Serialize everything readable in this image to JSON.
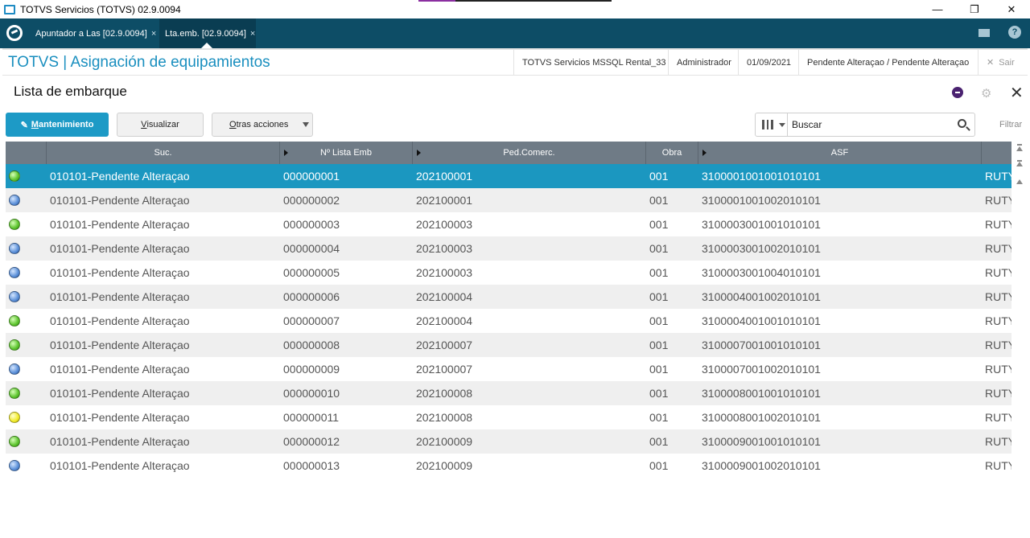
{
  "window": {
    "title": "TOTVS Servicios (TOTVS) 02.9.0094",
    "minimize": "—",
    "maximize": "❐",
    "close": "✕"
  },
  "tabs": [
    {
      "label": "Apuntador a Las [02.9.0094]",
      "close": "×"
    },
    {
      "label": "Lta.emb. [02.9.0094]",
      "close": "×"
    }
  ],
  "tabbar_icons": {
    "logo": "totvs-logo-icon",
    "mail": "mail-icon",
    "help": "help-icon",
    "help_glyph": "?"
  },
  "header": {
    "app_title": "TOTVS | Asignación de equipamientos",
    "environment": "TOTVS Servicios MSSQL Rental_33",
    "user": "Administrador",
    "date": "01/09/2021",
    "status": "Pendente Alteraçao / Pendente Alteraçao",
    "exit_label": "Sair",
    "exit_glyph": "✕"
  },
  "page": {
    "title": "Lista de embarque",
    "close_glyph": "✕",
    "gear_glyph": "⚙"
  },
  "toolbar": {
    "mantenimiento_first": "M",
    "mantenimiento_rest": "antenimiento",
    "visualizar_first": "V",
    "visualizar_rest": "isualizar",
    "otras_first": "O",
    "otras_rest": "tras acciones",
    "search_placeholder": "Buscar",
    "filtrar": "Filtrar"
  },
  "grid": {
    "columns": [
      "Suc.",
      "Nº Lista Emb",
      "Ped.Comerc.",
      "Obra",
      "ASF"
    ],
    "rows": [
      {
        "status": "green",
        "suc": "010101-Pendente Alteraçao",
        "lista": "000000001",
        "ped": "202100001",
        "obra": "001",
        "asf": "3100001001001010101",
        "extra": "RUTY",
        "selected": true
      },
      {
        "status": "blue",
        "suc": "010101-Pendente Alteraçao",
        "lista": "000000002",
        "ped": "202100001",
        "obra": "001",
        "asf": "3100001001002010101",
        "extra": "RUTY"
      },
      {
        "status": "green",
        "suc": "010101-Pendente Alteraçao",
        "lista": "000000003",
        "ped": "202100003",
        "obra": "001",
        "asf": "3100003001001010101",
        "extra": "RUTY"
      },
      {
        "status": "blue",
        "suc": "010101-Pendente Alteraçao",
        "lista": "000000004",
        "ped": "202100003",
        "obra": "001",
        "asf": "3100003001002010101",
        "extra": "RUTY"
      },
      {
        "status": "blue",
        "suc": "010101-Pendente Alteraçao",
        "lista": "000000005",
        "ped": "202100003",
        "obra": "001",
        "asf": "3100003001004010101",
        "extra": "RUTY"
      },
      {
        "status": "blue",
        "suc": "010101-Pendente Alteraçao",
        "lista": "000000006",
        "ped": "202100004",
        "obra": "001",
        "asf": "3100004001002010101",
        "extra": "RUTY"
      },
      {
        "status": "green",
        "suc": "010101-Pendente Alteraçao",
        "lista": "000000007",
        "ped": "202100004",
        "obra": "001",
        "asf": "3100004001001010101",
        "extra": "RUTY"
      },
      {
        "status": "green",
        "suc": "010101-Pendente Alteraçao",
        "lista": "000000008",
        "ped": "202100007",
        "obra": "001",
        "asf": "3100007001001010101",
        "extra": "RUTY"
      },
      {
        "status": "blue",
        "suc": "010101-Pendente Alteraçao",
        "lista": "000000009",
        "ped": "202100007",
        "obra": "001",
        "asf": "3100007001002010101",
        "extra": "RUTY"
      },
      {
        "status": "green",
        "suc": "010101-Pendente Alteraçao",
        "lista": "000000010",
        "ped": "202100008",
        "obra": "001",
        "asf": "3100008001001010101",
        "extra": "RUTY"
      },
      {
        "status": "yellow",
        "suc": "010101-Pendente Alteraçao",
        "lista": "000000011",
        "ped": "202100008",
        "obra": "001",
        "asf": "3100008001002010101",
        "extra": "RUTY"
      },
      {
        "status": "green",
        "suc": "010101-Pendente Alteraçao",
        "lista": "000000012",
        "ped": "202100009",
        "obra": "001",
        "asf": "3100009001001010101",
        "extra": "RUTY"
      },
      {
        "status": "blue",
        "suc": "010101-Pendente Alteraçao",
        "lista": "000000013",
        "ped": "202100009",
        "obra": "001",
        "asf": "3100009001002010101",
        "extra": "RUTY"
      }
    ]
  },
  "colors": {
    "accent": "#1d9ac6",
    "tabbar": "#0d4d66",
    "header_title": "#1a8fbf",
    "grid_header": "#6f7b86",
    "selected_row": "#1b97c0"
  }
}
